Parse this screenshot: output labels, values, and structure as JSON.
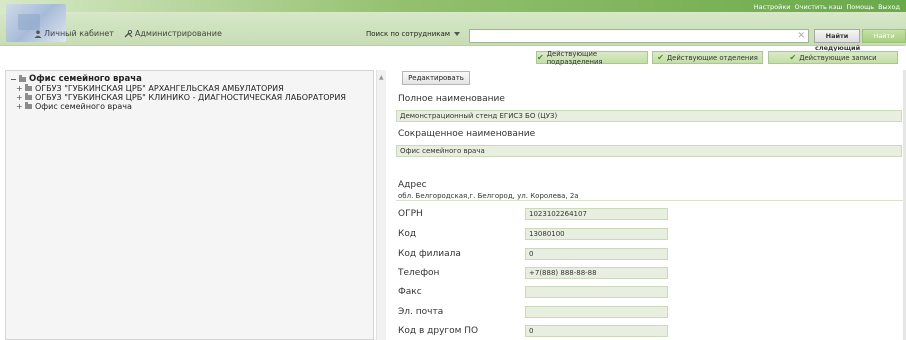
{
  "header": {
    "top_links": [
      "Настройки",
      "Очистить кэш",
      "Помощь",
      "Выход"
    ],
    "nav": [
      {
        "label": "Личный кабинет",
        "icon": "person-icon"
      },
      {
        "label": "Администрирование",
        "icon": "tools-icon"
      }
    ],
    "search": {
      "type_label": "Поиск по сотрудникам",
      "value": "",
      "find_next": "Найти следующий",
      "find_prev": "Найти предыдущий"
    }
  },
  "toolbar": {
    "filters": [
      "Действующие подразделения",
      "Действующие отделения",
      "Действующие записи"
    ]
  },
  "tree": {
    "root": "Офис семейного врача",
    "children": [
      "ОГБУЗ \"ГУБКИНСКАЯ ЦРБ\" АРХАНГЕЛЬСКАЯ АМБУЛАТОРИЯ",
      "ОГБУЗ \"ГУБКИНСКАЯ ЦРБ\" КЛИНИКО - ДИАГНОСТИЧЕСКАЯ ЛАБОРАТОРИЯ",
      "Офис семейного врача"
    ]
  },
  "detail": {
    "edit_button": "Редактировать",
    "full_name_label": "Полное наименование",
    "full_name": "Демонстрационный стенд ЕГИСЗ БО (ЦУЗ)",
    "short_name_label": "Сокращенное наименование",
    "short_name": "Офис семейного врача",
    "address_label": "Адрес",
    "address": "обл. Белгородская,г. Белгород, ул. Королева, 2а",
    "fields": [
      {
        "label": "ОГРН",
        "value": "1023102264107"
      },
      {
        "label": "Код",
        "value": "13080100"
      },
      {
        "label": "Код филиала",
        "value": "0"
      },
      {
        "label": "Телефон",
        "value": "+7(888) 888-88-88"
      },
      {
        "label": "Факс",
        "value": ""
      },
      {
        "label": "Эл. почта",
        "value": ""
      },
      {
        "label": "Код в другом ПО",
        "value": "0"
      }
    ]
  },
  "colors": {
    "header_green": "#c8ddb6",
    "accent_green": "#6aa94a",
    "field_bg": "#e9efe0",
    "check_green": "#4c8a1e"
  }
}
